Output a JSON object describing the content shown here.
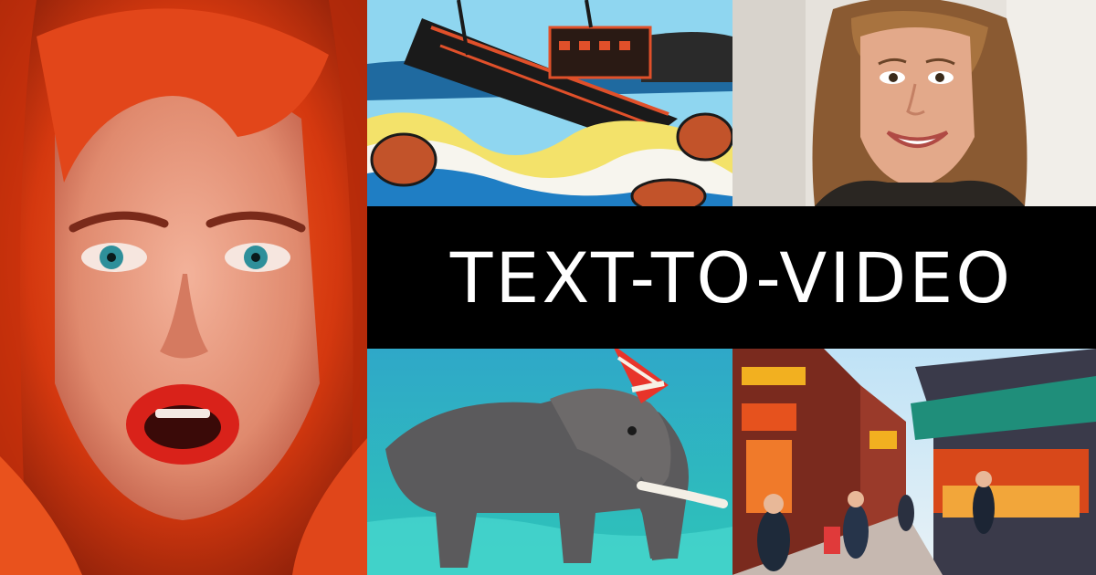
{
  "banner": {
    "title": "TEXT-TO-VIDEO"
  },
  "tiles": [
    {
      "subject": "red-haired-woman-portrait"
    },
    {
      "subject": "comic-style-ship-on-waves"
    },
    {
      "subject": "smiling-woman-portrait"
    },
    {
      "subject": "elephant-with-party-hat-underwater"
    },
    {
      "subject": "anime-style-street-market"
    }
  ],
  "colors": {
    "banner_background": "#000000",
    "banner_text": "#ffffff"
  }
}
